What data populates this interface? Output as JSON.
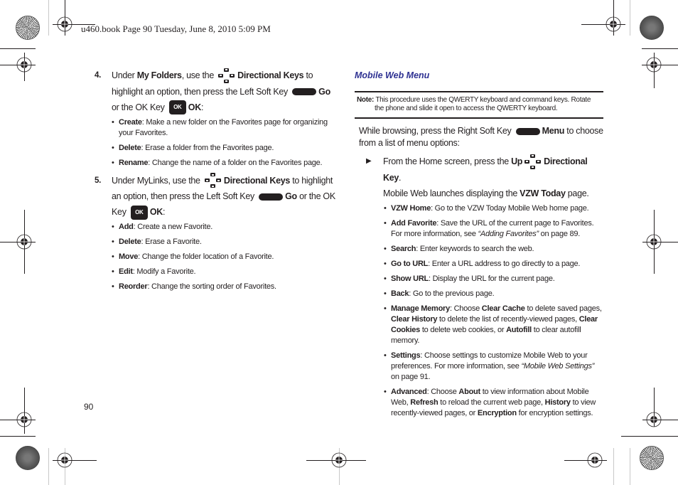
{
  "header": {
    "print_info": "u460.book  Page 90  Tuesday, June 8, 2010  5:09 PM"
  },
  "icons": {
    "directional_keys": "directional-keys-icon",
    "left_soft_key": "soft-key-icon",
    "ok_key": "ok-key-icon",
    "ok_key_label": "OK",
    "arrow": "▶",
    "bullet": "•"
  },
  "left": {
    "step4": {
      "number": "4.",
      "t1": "Under ",
      "b1": "My Folders",
      "t2": ", use the ",
      "b2": "Directional Keys",
      "t3": " to highlight an option, then press the Left Soft Key ",
      "b3": "Go",
      "t4": " or the OK Key ",
      "b4": "OK",
      "t5": ":",
      "bullets": [
        {
          "term": "Create",
          "desc": ": Make a new folder on the Favorites page for organizing your Favorites."
        },
        {
          "term": "Delete",
          "desc": ": Erase a folder from the Favorites page."
        },
        {
          "term": "Rename",
          "desc": ": Change the name of a folder on the Favorites page."
        }
      ]
    },
    "step5": {
      "number": "5.",
      "t1": "Under MyLinks, use the ",
      "b1": "Directional Keys",
      "t2": " to highlight an option, then press the Left Soft Key ",
      "b2": "Go",
      "t3": " or the OK Key ",
      "b3": "OK",
      "t4": ":",
      "bullets": [
        {
          "term": "Add",
          "desc": ": Create a new Favorite."
        },
        {
          "term": "Delete",
          "desc": ": Erase a Favorite."
        },
        {
          "term": "Move",
          "desc": ": Change the folder location of a Favorite."
        },
        {
          "term": "Edit",
          "desc": ": Modify a Favorite."
        },
        {
          "term": "Reorder",
          "desc": ": Change the sorting order of Favorites."
        }
      ]
    }
  },
  "right": {
    "section_title": "Mobile Web Menu",
    "note": {
      "label": "Note:",
      "line1": " This procedure uses the QWERTY keyboard and command keys. Rotate",
      "line2": "the phone and slide it open to access the QWERTY keyboard."
    },
    "intro": {
      "t1": "While browsing, press the Right Soft Key ",
      "b1": "Menu",
      "t2": " to choose from a list of menu options:"
    },
    "arrow_step": {
      "t1": "From the Home screen, press the ",
      "b1": "Up",
      "b2": "Directional Key",
      "t2": ".",
      "t3": "Mobile Web launches displaying the ",
      "b3": "VZW Today",
      "t4": " page."
    },
    "bullets": {
      "vzw_home": {
        "term": "VZW Home",
        "desc": ": Go to the VZW Today Mobile Web home page."
      },
      "add_favorite": {
        "term": "Add Favorite",
        "desc": ": Save the URL of the current page to Favorites. For more information, see ",
        "ref": "“Adding Favorites”",
        "tail": " on page 89."
      },
      "search": {
        "term": "Search",
        "desc": ": Enter keywords to search the web."
      },
      "go_to_url": {
        "term": "Go to URL",
        "desc": ": Enter a URL address to go directly to a page."
      },
      "show_url": {
        "term": "Show URL",
        "desc": ": Display the URL for the current page."
      },
      "back": {
        "term": "Back",
        "desc": ": Go to the previous page."
      },
      "manage_memory": {
        "term": "Manage Memory",
        "d1": ": Choose ",
        "b1": "Clear Cache",
        "d2": " to delete saved pages, ",
        "b2": "Clear History",
        "d3": " to delete the list of recently-viewed pages, ",
        "b3": "Clear Cookies",
        "d4": " to delete web cookies, or ",
        "b4": "Autofill",
        "d5": " to clear autofill memory."
      },
      "settings": {
        "term": "Settings",
        "desc": ": Choose settings to customize Mobile Web to your preferences. For more information, see ",
        "ref": "“Mobile Web Settings”",
        "tail": " on page 91."
      },
      "advanced": {
        "term": "Advanced",
        "d1": ": Choose ",
        "b1": "About",
        "d2": " to view information about Mobile Web, ",
        "b2": "Refresh",
        "d3": " to reload the current web page, ",
        "b3": "History",
        "d4": " to view recently-viewed pages, or ",
        "b4": "Encryption",
        "d5": " for encryption settings."
      }
    }
  },
  "footer": {
    "page_number": "90"
  }
}
